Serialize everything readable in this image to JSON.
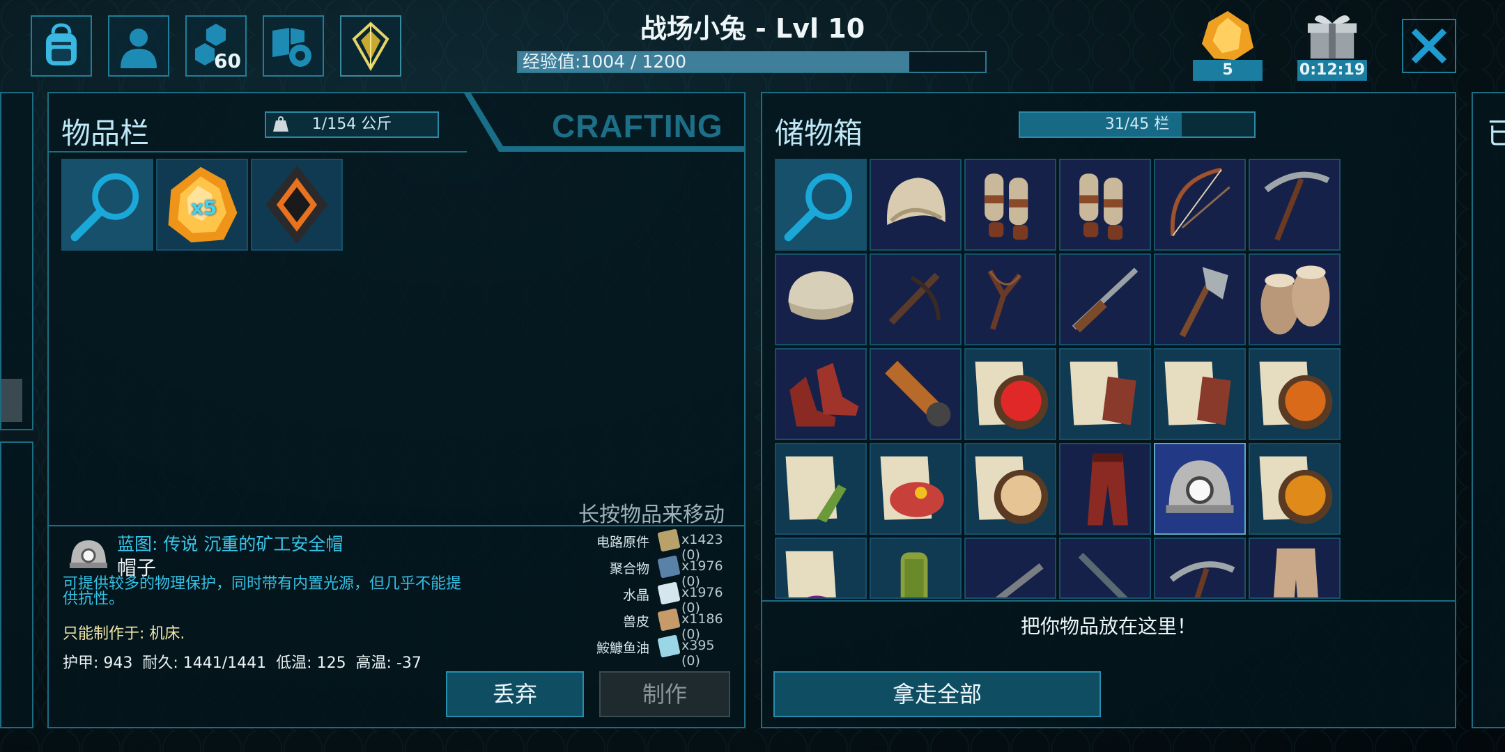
{
  "header": {
    "title": "战场小兔 - Lvl 10",
    "xp_label": "经验值:1004 / 1200",
    "xp_progress": 0.837,
    "tab_engram_points": "60"
  },
  "resources": {
    "element_count": "5",
    "gift_timer": "0:12:19"
  },
  "inventory": {
    "title": "物品栏",
    "weight": "1/154 公斤",
    "crafting_tab": "CRAFTING",
    "slot_quantity": "x5",
    "hint": "长按物品来移动"
  },
  "detail": {
    "name": "蓝图: 传说 沉重的矿工安全帽",
    "type": "帽子",
    "description": "可提供较多的物理保护，同时带有内置光源，但几乎不能提供抗性。",
    "craft_at": "只能制作于: 机床.",
    "stats": "护甲: 943  耐久: 1441/1441  低温: 125  高温: -37"
  },
  "materials": [
    {
      "name": "电路原件",
      "qty": "x1423 (0)",
      "icon": "circuit-icon",
      "color": "#b8a26a"
    },
    {
      "name": "聚合物",
      "qty": "x1976 (0)",
      "icon": "polymer-icon",
      "color": "#5a82a8"
    },
    {
      "name": "水晶",
      "qty": "x1976 (0)",
      "icon": "crystal-icon",
      "color": "#d6e6ee"
    },
    {
      "name": "兽皮",
      "qty": "x1186 (0)",
      "icon": "hide-icon",
      "color": "#c79a6a"
    },
    {
      "name": "鮟鱇鱼油",
      "qty": "x395 (0)",
      "icon": "oil-icon",
      "color": "#9ad6e6"
    }
  ],
  "actions": {
    "drop": "丢弃",
    "craft": "制作",
    "take_all": "拿走全部"
  },
  "storage": {
    "title": "储物箱",
    "capacity": "31/45 栏",
    "drop_hint": "把你物品放在这里！",
    "side_title_partial": "已"
  },
  "colors": {
    "accent": "#1b7ea1",
    "panel_border": "#1c6c84",
    "title_text": "#bfe8f6"
  }
}
